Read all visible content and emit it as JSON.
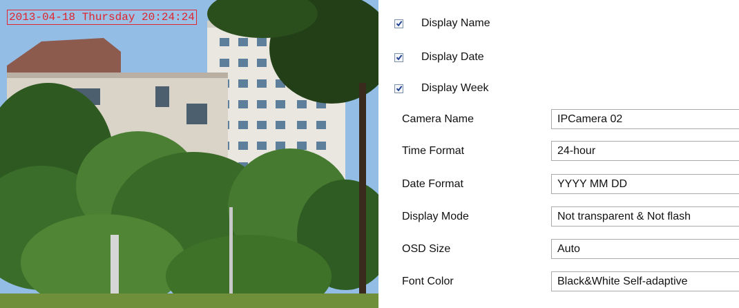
{
  "preview": {
    "osd_text": "2013-04-18 Thursday 20:24:24"
  },
  "checkboxes": [
    {
      "label": "Display Name",
      "checked": true
    },
    {
      "label": "Display Date",
      "checked": true
    },
    {
      "label": "Display Week",
      "checked": true
    }
  ],
  "fields": {
    "camera_name": {
      "label": "Camera Name",
      "value": "IPCamera 02"
    },
    "time_format": {
      "label": "Time Format",
      "value": "24-hour"
    },
    "date_format": {
      "label": "Date Format",
      "value": "YYYY MM DD"
    },
    "display_mode": {
      "label": "Display Mode",
      "value": "Not transparent & Not flash"
    },
    "osd_size": {
      "label": "OSD Size",
      "value": "Auto"
    },
    "font_color": {
      "label": "Font Color",
      "value": "Black&White Self-adaptive"
    }
  },
  "icons": {
    "checkmark": "check-icon",
    "dropdown": "dropdown-arrow-icon"
  },
  "colors": {
    "osd_red": "#e1232d",
    "checkbox_border": "#7a8ea6",
    "checkmark": "#1f3f8f",
    "control_border": "#a9a9a9"
  }
}
